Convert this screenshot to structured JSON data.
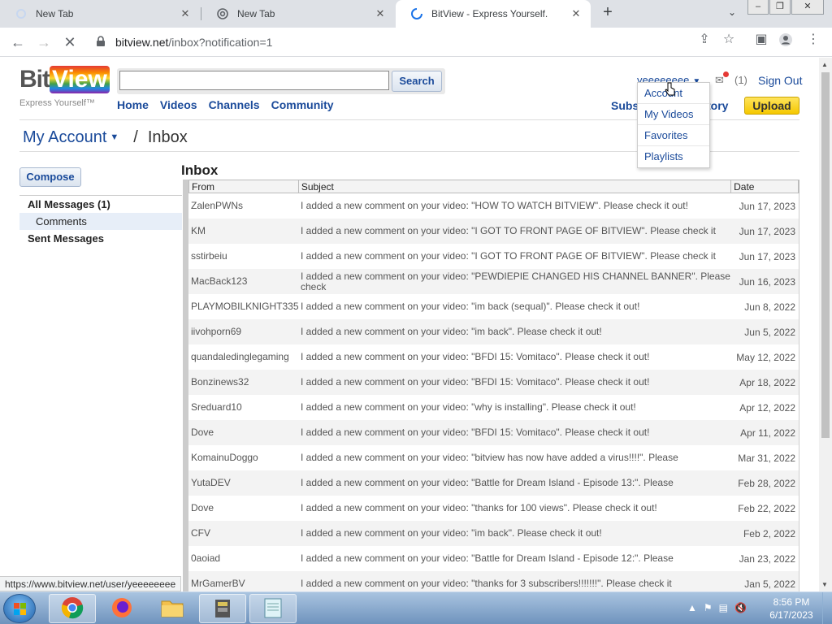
{
  "browser": {
    "tabs": [
      {
        "title": "New Tab",
        "active": false
      },
      {
        "title": "New Tab",
        "active": false
      },
      {
        "title": "BitView - Express Yourself.",
        "active": true
      }
    ],
    "url_host": "bitview.net",
    "url_path": "/inbox?notification=1",
    "status_url": "https://www.bitview.net/user/yeeeeeeee"
  },
  "site": {
    "logo_bit": "Bit",
    "logo_view": "View",
    "tagline": "Express Yourself™",
    "search_button": "Search",
    "search_value": "",
    "nav": [
      "Home",
      "Videos",
      "Channels",
      "Community"
    ],
    "username": "yeeeeeeee",
    "mail_count": "(1)",
    "sign_out": "Sign Out",
    "subscriptions": "Subs",
    "history": "tory",
    "upload": "Upload",
    "user_menu": [
      "Account",
      "My Videos",
      "Favorites",
      "Playlists"
    ]
  },
  "breadcrumb": {
    "account": "My Account",
    "separator": "/",
    "page": "Inbox"
  },
  "sidebar": {
    "compose": "Compose",
    "items": [
      {
        "label": "All Messages (1)"
      },
      {
        "label": "Comments"
      },
      {
        "label": "Sent Messages"
      }
    ]
  },
  "inbox": {
    "title": "Inbox",
    "columns": [
      "From",
      "Subject",
      "Date"
    ],
    "rows": [
      {
        "from": "ZalenPWNs",
        "subject": "I added a new comment on your video: \"HOW TO WATCH BITVIEW\". Please check it out!",
        "date": "Jun 17, 2023"
      },
      {
        "from": "KM",
        "subject": "I added a new comment on your video: \"I GOT TO FRONT PAGE OF BITVIEW\". Please check it",
        "date": "Jun 17, 2023"
      },
      {
        "from": "sstirbeiu",
        "subject": "I added a new comment on your video: \"I GOT TO FRONT PAGE OF BITVIEW\". Please check it",
        "date": "Jun 17, 2023"
      },
      {
        "from": "MacBack123",
        "subject": "I added a new comment on your video: \"PEWDIEPIE CHANGED HIS CHANNEL BANNER\". Please check",
        "date": "Jun 16, 2023"
      },
      {
        "from": "PLAYMOBILKNIGHT335",
        "subject": "I added a new comment on your video: \"im back (sequal)\". Please check it out!",
        "date": "Jun 8, 2022"
      },
      {
        "from": "iivohporn69",
        "subject": "I added a new comment on your video: \"im back\". Please check it out!",
        "date": "Jun 5, 2022"
      },
      {
        "from": "quandaledinglegaming",
        "subject": "I added a new comment on your video: \"BFDI 15: Vomitaco\". Please check it out!",
        "date": "May 12, 2022"
      },
      {
        "from": "Bonzinews32",
        "subject": "I added a new comment on your video: \"BFDI 15: Vomitaco\". Please check it out!",
        "date": "Apr 18, 2022"
      },
      {
        "from": "Sreduard10",
        "subject": "I added a new comment on your video: \"why is installing\". Please check it out!",
        "date": "Apr 12, 2022"
      },
      {
        "from": "Dove",
        "subject": "I added a new comment on your video: \"BFDI 15: Vomitaco\". Please check it out!",
        "date": "Apr 11, 2022"
      },
      {
        "from": "KomainuDoggo",
        "subject": "I added a new comment on your video: \"bitview has now have added a virus!!!!\". Please",
        "date": "Mar 31, 2022"
      },
      {
        "from": "YutaDEV",
        "subject": "I added a new comment on your video: \"Battle for Dream Island - Episode 13:\". Please",
        "date": "Feb 28, 2022"
      },
      {
        "from": "Dove",
        "subject": "I added a new comment on your video: \"thanks for 100 views\". Please check it out!",
        "date": "Feb 22, 2022"
      },
      {
        "from": "CFV",
        "subject": "I added a new comment on your video: \"im back\". Please check it out!",
        "date": "Feb 2, 2022"
      },
      {
        "from": "0aoiad",
        "subject": "I added a new comment on your video: \"Battle for Dream Island - Episode 12:\". Please",
        "date": "Jan 23, 2022"
      },
      {
        "from": "MrGamerBV",
        "subject": "I added a new comment on your video: \"thanks for 3 subscribers!!!!!!!\". Please check it",
        "date": "Jan 5, 2022"
      }
    ]
  },
  "taskbar": {
    "time": "8:56 PM",
    "date": "6/17/2023",
    "apps": [
      "chrome-icon",
      "firefox-icon",
      "folder-icon",
      "archive-icon",
      "notepad-icon"
    ]
  }
}
